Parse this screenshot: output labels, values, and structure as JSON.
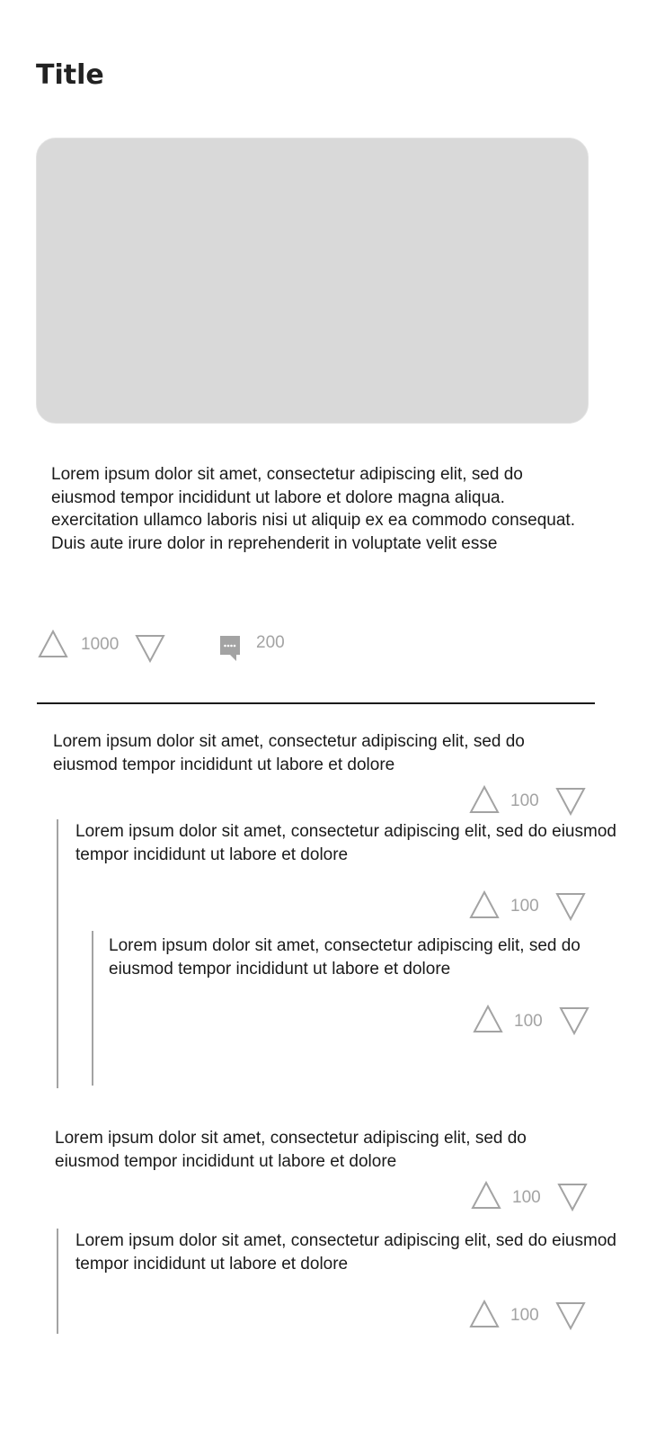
{
  "post": {
    "title": "Title",
    "body": "Lorem ipsum dolor sit amet, consectetur adipiscing elit, sed do eiusmod tempor incididunt ut labore et dolore magna aliqua. exercitation ullamco laboris nisi ut aliquip ex ea commodo consequat. Duis aute irure dolor in reprehenderit in voluptate velit esse",
    "votes": "1000",
    "comment_count": "200"
  },
  "comments": [
    {
      "text": "Lorem ipsum dolor sit amet, consectetur adipiscing elit, sed do eiusmod tempor incididunt ut labore et dolore",
      "votes": "100"
    },
    {
      "text": "Lorem ipsum dolor sit amet, consectetur adipiscing elit, sed do eiusmod tempor incididunt ut labore et dolore",
      "votes": "100"
    },
    {
      "text": "Lorem ipsum dolor sit amet, consectetur adipiscing elit, sed do eiusmod tempor incididunt ut labore et dolore",
      "votes": "100"
    },
    {
      "text": "Lorem ipsum dolor sit amet, consectetur adipiscing elit, sed do eiusmod tempor incididunt ut labore et dolore",
      "votes": "100"
    },
    {
      "text": "Lorem ipsum dolor sit amet, consectetur adipiscing elit, sed do eiusmod tempor incididunt ut labore et dolore",
      "votes": "100"
    }
  ],
  "icons": {
    "upvote": "upvote-triangle-icon",
    "downvote": "downvote-triangle-icon",
    "comments": "comment-bubble-icon"
  },
  "colors": {
    "muted": "#a3a3a3",
    "image_placeholder": "#d9d9d9",
    "text": "#1a1a1a"
  }
}
